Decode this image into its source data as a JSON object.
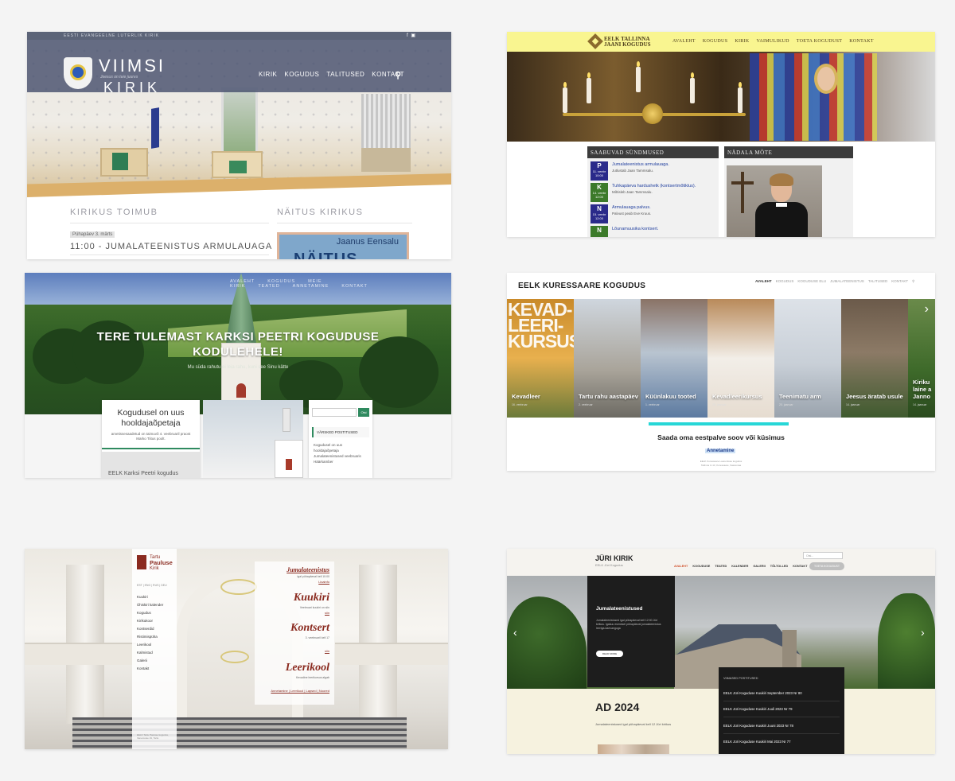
{
  "tile1": {
    "topstrip": "EESTI EVANGEELNE LUTERLIK KIRIK",
    "social": "f  ▣",
    "logo_line1": "VIIMSI",
    "logo_tag": "Jeesus on teie juures",
    "logo_line2": "KIRIK",
    "nav": [
      "KIRIK",
      "KOGUDUS",
      "TALITUSED",
      "KONTAKT"
    ],
    "heading_left": "KIRIKUS TOIMUB",
    "heading_right": "NÄITUS KIRIKUS",
    "date": "Pühapäev 3. märts",
    "event": "11:00 - JUMALATEENISTUS ARMULAUAGA",
    "poster_name": "Jaanus Eensalu",
    "poster_title": "NÄITUS"
  },
  "tile2": {
    "brand_line1": "EELK TALLINNA",
    "brand_line2": "JAANI KOGUDUS",
    "nav": [
      "AVALEHT",
      "KOGUDUS",
      "KIRIK",
      "VAIMULIKUD",
      "TOETA KOGUDUST",
      "KONTAKT"
    ],
    "events_title": "SAABUVAD SÜNDMUSED",
    "quote_title": "NÄDALA MÕTE",
    "events": [
      {
        "day": "P",
        "date": "11. veebr",
        "time": "10:00",
        "color": "#2a2a8a",
        "title": "Jumalateenistus armulauaga.",
        "sub": "Jutlustab Jaan Tammsalu."
      },
      {
        "day": "K",
        "date": "14. veebr",
        "time": "12:00",
        "color": "#3c7a2a",
        "title": "Tuhkapäeva hardushetk (kontsertmõtiklus).",
        "sub": "Mõtisleb Jaan Tammsalu."
      },
      {
        "day": "N",
        "date": "15. veebr",
        "time": "12:00",
        "color": "#2a2a8a",
        "title": "Armulauaga palvus.",
        "sub": "Palvust peab Eve Kruus."
      },
      {
        "day": "N",
        "date": "",
        "time": "",
        "color": "#3c7a2a",
        "title": "Lõunamuusika kontsert.",
        "sub": ""
      }
    ]
  },
  "tile3": {
    "nav": [
      "AVALEHT",
      "KOGUDUS",
      "MEIE KIRIK",
      "TEATED",
      "ANNETAMINE",
      "KONTAKT"
    ],
    "title_line1": "TERE TULEMAST KARKSI PEETRI KOGUDUSE",
    "title_line2": "KODULEHELE!",
    "subtitle": "Mu süda rahutu ei leia rahu, kuni see Sinu kätte",
    "card_title": "Kogudusel on uus hooldajaõpetaja",
    "card_text": "ametissesaadetud on taimuvõ 4. veebruaril praost Marko Tiitus poolt.",
    "card_img_text": "EELK Karksi Peetri kogudus",
    "search_btn": "Otsi",
    "sidebar_heading": "VÄRSKED POSTITUSED",
    "sidebar_items": [
      "Kogudusel on uus",
      "hooldajaõpetaja",
      "Jumalateenistused veebruaris",
      "Häärkamber"
    ]
  },
  "tile4": {
    "brand": "EELK KURESSAARE KOGUDUS",
    "nav": [
      "AVALEHT",
      "KOGUDUS",
      "KOGUDUSE ELU",
      "JUMALATEENISTUS",
      "TALITUSED",
      "KONTAKT"
    ],
    "slides": [
      {
        "caption": "Kevadleer",
        "date": "16. veebruar",
        "bg": "linear-gradient(180deg,#c98a2a 0%,#e8b04e 50%,#6b7a3a 100%)"
      },
      {
        "caption": "Tartu rahu aastapäev",
        "date": "2. veebruar",
        "bg": "linear-gradient(180deg,#cfd6de 0%,#a9a49a 60%,#6c6a63 100%)"
      },
      {
        "caption": "Küünlakuu tooted",
        "date": "1. veebruar",
        "bg": "linear-gradient(180deg,#8a7366 0%,#b9c4d0 45%,#5c7aa0 100%)"
      },
      {
        "caption": "Kevadleerikursus",
        "date": "25. jaanuar",
        "bg": "linear-gradient(180deg,#b98a5a 0%,#f2eee8 50%,#e6dcd0 100%)"
      },
      {
        "caption": "Teenimatu arm",
        "date": "20. jaanuar",
        "bg": "linear-gradient(180deg,#dde2e8 0%,#c8cfd7 55%,#9aa3ad 100%)"
      },
      {
        "caption": "Jeesus äratab usule",
        "date": "14. jaanuar",
        "bg": "linear-gradient(180deg,#6b5a4a 0%,#8c7a66 45%,#3e5a2e 100%)"
      },
      {
        "caption": "Kiriku laine a Janno",
        "date": "14. jaanuar",
        "bg": "linear-gradient(180deg,#6a8a4a 0%,#3e6a2a 60%,#2a4a1e 100%)"
      }
    ],
    "big_slide_text_1": "KEVAD-",
    "big_slide_text_2": "LEERI-",
    "big_slide_text_3": "KURSUS",
    "heading": "Saada oma eestpalve soov või küsimus",
    "link": "Annetamine",
    "footer1": "EELK Kuressaare Laurentiuse kogudus",
    "footer2": "Tallinna tn 13, Kuressaare, Saaremaa"
  },
  "tile5": {
    "logo_small": "Tartu",
    "logo_big": "Pauluse",
    "logo_sub": "Kirik",
    "lang": "EST | ENG | RUS | DEU",
    "menu": [
      "Kuukiri",
      "Ühiskiri kalender",
      "Kogudus",
      "Kirikukoor",
      "Kontserdid",
      "Ristimispüha",
      "Leerikool",
      "Kalmistud",
      "Galerii",
      "Kontakt"
    ],
    "address": "EELK Tartu Pauluse kogudus, Vanemuise 19, Tartu",
    "ads": [
      {
        "title": "Jumalateenistus",
        "text": "igal pühapäeval kell 10:00",
        "link": "Lisainfo"
      },
      {
        "title": "Kuukiri",
        "text": "Veebruari kuukiri on siin",
        "link": "siin"
      },
      {
        "title": "Kontsert",
        "text": "3. veebruaril kell 17",
        "link": "siin"
      },
      {
        "title": "Leerikool",
        "text": "Kevadine leerikursus algab",
        "link": "siin"
      }
    ],
    "bottom_links": "Annetamine  |  Leerikool  |  Lapsed  |  Noored"
  },
  "tile6": {
    "brand": "JÜRI KIRIK",
    "tag": "EELK Jüri Kogudus",
    "search_placeholder": "Otsi...",
    "nav": [
      "AVALEHT",
      "KOGUDUSE",
      "TEATED",
      "KALENDER",
      "GALERII",
      "TÕLTOLLED",
      "KONTAKT"
    ],
    "nav_button": "TOETA KOGUDUST",
    "hero_title": "Jumalateenistused",
    "hero_text": "Jumalateenistused igal pühapäeval kell 12:00 Jüri kirikus. Igakuu esimesel pühapäeval jumalateenistus leeriga-kaevanguga",
    "read_more": "READ MORE",
    "ad_title": "AD 2024",
    "ad_sub": "Jumalateenistused igal pühapäeval kell 12 Jüri kirikus",
    "posts_title": "VIIMASED POSTITUSED",
    "posts": [
      "EELK Jüri Koguduse Kuukiri September 2023 Nr 80",
      "EELK Jüri Koguduse Kuukiri Juuli 2023 Nr 79",
      "EELK Jüri Koguduse Kuukiri Juuni 2023 Nr 78",
      "EELK Jüri Koguduse Kuukiri Mai 2023 Nr 77"
    ]
  }
}
